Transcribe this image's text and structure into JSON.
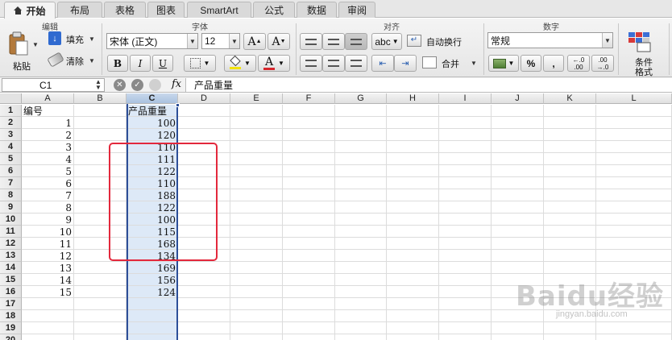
{
  "tabs": [
    {
      "label": "开始",
      "active": true
    },
    {
      "label": "布局"
    },
    {
      "label": "表格"
    },
    {
      "label": "图表"
    },
    {
      "label": "SmartArt"
    },
    {
      "label": "公式"
    },
    {
      "label": "数据"
    },
    {
      "label": "审阅"
    }
  ],
  "ribbon": {
    "groups": {
      "edit": "编辑",
      "font": "字体",
      "align": "对齐",
      "number": "数字"
    },
    "paste_label": "粘贴",
    "fill_label": "填充",
    "clear_label": "清除",
    "font_name": "宋体 (正文)",
    "font_size": "12",
    "wrap_label": "自动换行",
    "merge_label": "合并",
    "abc_label": "abc",
    "number_format": "常规",
    "percent": "%",
    "comma": ",",
    "cond_format_label": "条件\n格式",
    "cond_line1": "条件",
    "cond_line2": "格式",
    "bold": "B",
    "italic": "I",
    "underline": "U",
    "grow": "A",
    "shrink": "A",
    "font_color": "A",
    "inc_dec_top": "←.0",
    "inc_dec_bottom": ".00",
    "dec_top": ".00",
    "dec_bottom": "→.0"
  },
  "formula_bar": {
    "name_box": "C1",
    "fx": "fx",
    "content": "产品重量"
  },
  "columns": [
    "A",
    "B",
    "C",
    "D",
    "E",
    "F",
    "G",
    "H",
    "I",
    "J",
    "K",
    "L"
  ],
  "rows": [
    "1",
    "2",
    "3",
    "4",
    "5",
    "6",
    "7",
    "8",
    "9",
    "10",
    "11",
    "12",
    "13",
    "14",
    "15",
    "16",
    "17",
    "18",
    "19",
    "20"
  ],
  "sheet": {
    "header_a": "编号",
    "header_c": "产品重量",
    "ids": [
      "1",
      "2",
      "3",
      "4",
      "5",
      "6",
      "7",
      "8",
      "9",
      "10",
      "11",
      "12",
      "13",
      "14",
      "15"
    ],
    "weights": [
      "100",
      "120",
      "110",
      "111",
      "122",
      "110",
      "188",
      "122",
      "100",
      "115",
      "168",
      "134",
      "169",
      "156",
      "124"
    ]
  },
  "watermark": {
    "logo": "Baidu经验",
    "url": "jingyan.baidu.com"
  },
  "colors": {
    "selection_fill": "#dde9f7",
    "selection_border": "#2d4f99",
    "highlight_box": "#e3283c"
  }
}
